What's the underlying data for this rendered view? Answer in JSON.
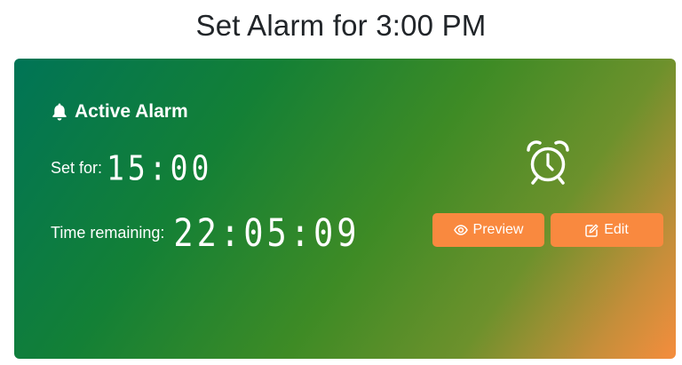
{
  "page": {
    "title": "Set Alarm for 3:00 PM"
  },
  "card": {
    "header": "Active Alarm",
    "header_icon": "bell-icon",
    "set_label": "Set for:",
    "set_time": "15:00",
    "remaining_label": "Time remaining:",
    "remaining_time": "22:05:09",
    "alarm_icon": "alarm-clock-icon",
    "gradient_colors": [
      "#007456",
      "#3e8b25",
      "#f58d3d"
    ]
  },
  "actions": {
    "preview_label": "Preview",
    "preview_icon": "eye-icon",
    "edit_label": "Edit",
    "edit_icon": "edit-icon",
    "button_color": "#f9893f"
  }
}
